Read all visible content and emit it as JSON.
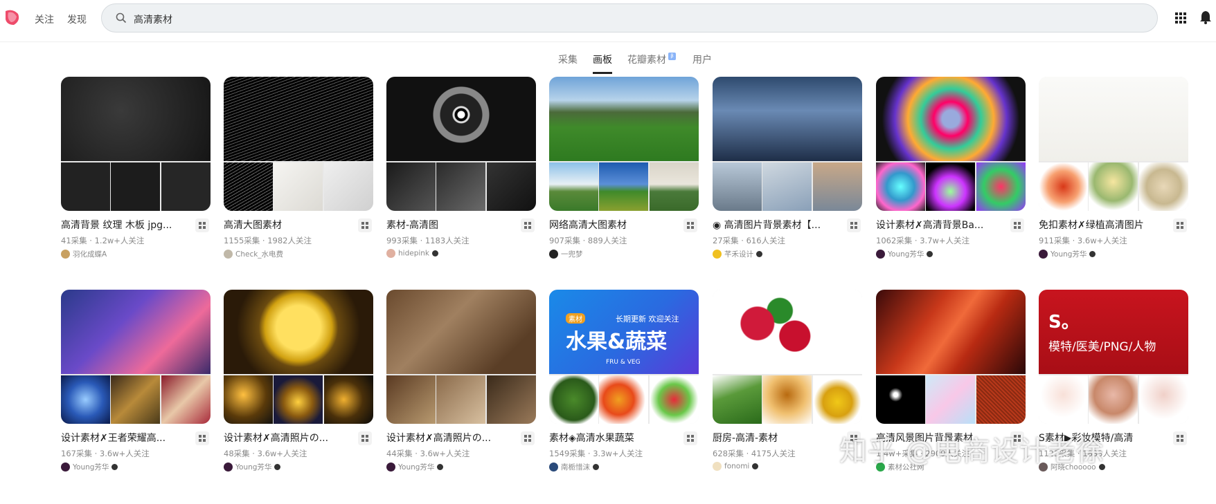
{
  "header": {
    "nav": [
      "关注",
      "发现"
    ],
    "search": {
      "value": "高清素材"
    }
  },
  "tabs": [
    {
      "label": "采集"
    },
    {
      "label": "画板",
      "active": true
    },
    {
      "label": "花瓣素材",
      "badge": "β"
    },
    {
      "label": "用户"
    }
  ],
  "boards": [
    {
      "title": "高清背景 纹理 木板 jpg...",
      "stats": "41采集 · 1.2w+人关注",
      "owner": "羽化成蝶A"
    },
    {
      "title": "高清大图素材",
      "stats": "1155采集 · 1982人关注",
      "owner": "Check_水电费"
    },
    {
      "title": "素材-高清图",
      "stats": "993采集 · 1183人关注",
      "owner": "hidepink",
      "verified": true
    },
    {
      "title": "网络高清大图素材",
      "stats": "907采集 · 889人关注",
      "owner": "一兜梦"
    },
    {
      "title": "◉ 高清图片背景素材【...",
      "stats": "27采集 · 616人关注",
      "owner": "芊禾设计",
      "verified": true
    },
    {
      "title": "设计素材✗高清背景Ba...",
      "stats": "1062采集 · 3.7w+人关注",
      "owner": "Young芳华",
      "verified": true
    },
    {
      "title": "免扣素材✗绿植高清图片",
      "stats": "911采集 · 3.6w+人关注",
      "owner": "Young芳华",
      "verified": true
    },
    {
      "title": "设计素材✗王者荣耀高...",
      "stats": "167采集 · 3.6w+人关注",
      "owner": "Young芳华",
      "verified": true
    },
    {
      "title": "设计素材✗高清照片の...",
      "stats": "48采集 · 3.6w+人关注",
      "owner": "Young芳华",
      "verified": true
    },
    {
      "title": "设计素材✗高清照片の...",
      "stats": "44采集 · 3.6w+人关注",
      "owner": "Young芳华",
      "verified": true
    },
    {
      "title": "素材◈高清水果蔬菜",
      "stats": "1549采集 · 3.3w+人关注",
      "owner": "南栀惜沫",
      "verified": true
    },
    {
      "title": "厨房-高清-素材",
      "stats": "628采集 · 4175人关注",
      "owner": "fonomi",
      "verified": true
    },
    {
      "title": "高清风景图片背景素材",
      "stats": "1.4w+采集 · 2909人关注",
      "owner": "素材公社网"
    },
    {
      "title": "S素材▶彩妆模特/高清",
      "stats": "1123采集 · 1833人关注",
      "owner": "阿晓chooooo",
      "verified": true
    }
  ],
  "cover_text": {
    "fruit_tag": "素材",
    "fruit_sub": "长期更新 欢迎关注",
    "fruit_title": "水果&蔬菜",
    "fruit_en": "FRU & VEG",
    "model_s": "S。",
    "model_text": "模特/医美/PNG/人物"
  },
  "watermark": "知乎 @电商设计老徐"
}
